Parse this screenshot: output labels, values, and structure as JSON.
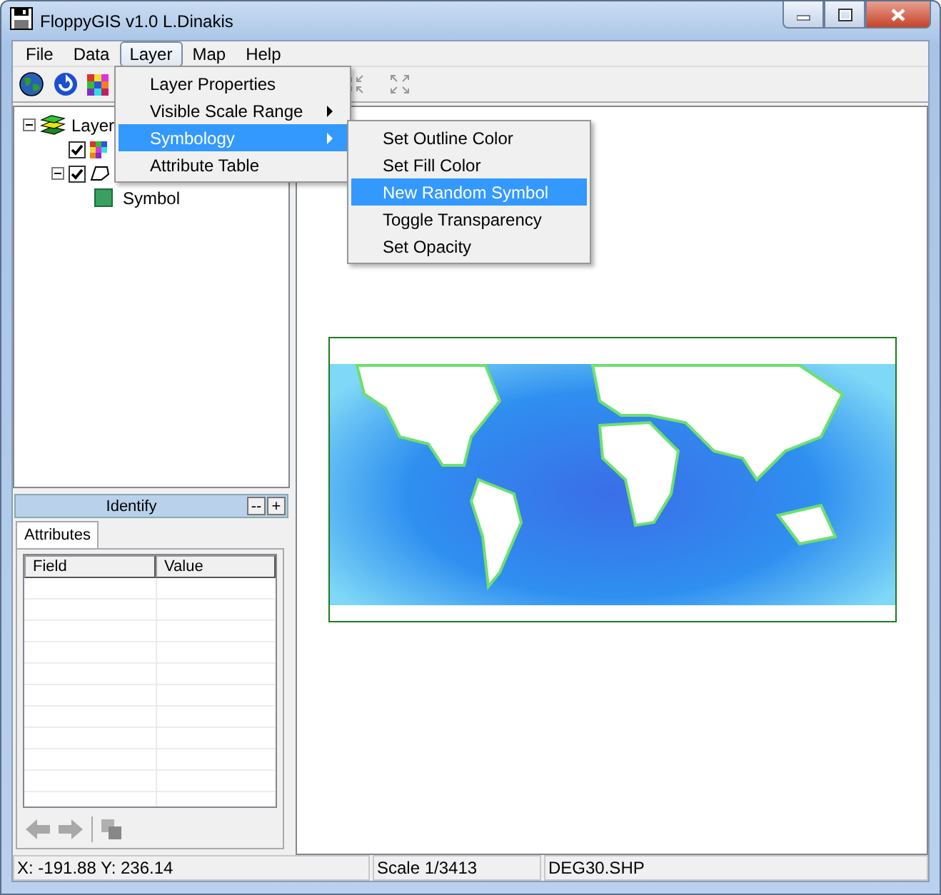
{
  "window": {
    "title": "FloppyGIS v1.0 L.Dinakis"
  },
  "menu_bar": [
    {
      "label": "File",
      "selected": false
    },
    {
      "label": "Data",
      "selected": false
    },
    {
      "label": "Layer",
      "selected": true
    },
    {
      "label": "Map",
      "selected": false
    },
    {
      "label": "Help",
      "selected": false
    }
  ],
  "layer_menu": [
    {
      "label": "Layer Properties",
      "submenu": false,
      "selected": false
    },
    {
      "label": "Visible Scale Range",
      "submenu": true,
      "selected": false
    },
    {
      "label": "Symbology",
      "submenu": true,
      "selected": true
    },
    {
      "label": "Attribute Table",
      "submenu": false,
      "selected": false
    }
  ],
  "symbology_menu": [
    {
      "label": "Set Outline Color",
      "selected": false
    },
    {
      "label": "Set Fill Color",
      "selected": false
    },
    {
      "label": "New Random Symbol",
      "selected": true
    },
    {
      "label": "Toggle Transparency",
      "selected": false
    },
    {
      "label": "Set Opacity",
      "selected": false
    }
  ],
  "layer_tree": {
    "label": "Layer",
    "expanded": true,
    "children": [
      {
        "kind": "raster",
        "checked": true
      },
      {
        "kind": "polygon",
        "checked": true,
        "expanded": true,
        "children": [
          {
            "label": "Symbol"
          }
        ]
      }
    ]
  },
  "identify_panel": {
    "title": "Identify",
    "buttons": [
      "--",
      "+"
    ]
  },
  "tabs": [
    {
      "label": "Attributes",
      "selected": true
    }
  ],
  "attribute_table": {
    "columns": [
      "Field",
      "Value"
    ]
  },
  "status_bar": {
    "coordinates": "X: -191.88 Y: 236.14",
    "scale": "Scale 1/3413",
    "file": "DEG30.SHP"
  }
}
